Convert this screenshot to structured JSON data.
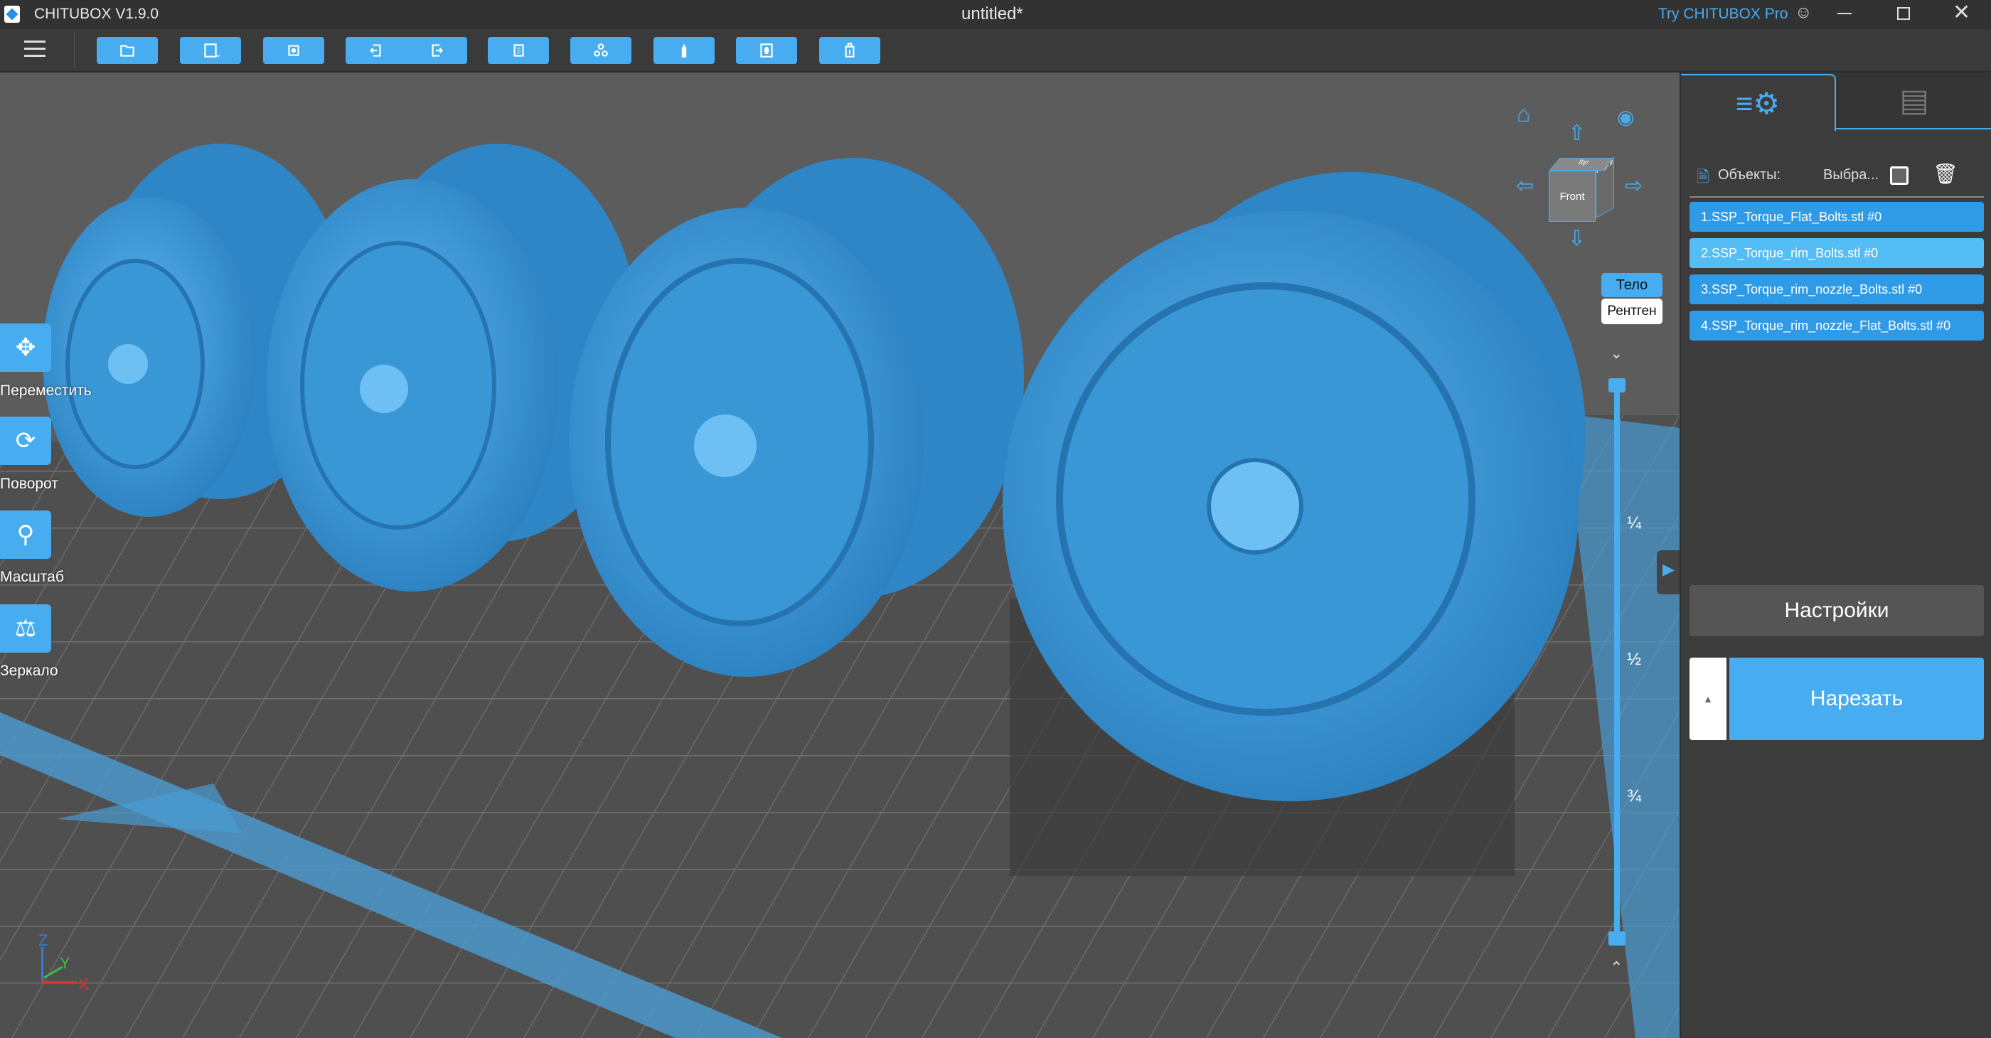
{
  "app": {
    "title": "CHITUBOX V1.9.0",
    "document": "untitled*",
    "pro_link": "Try CHITUBOX Pro"
  },
  "toolbar": {
    "buttons": [
      "open-file",
      "save",
      "auto-layout",
      "undo",
      "redo",
      "copy",
      "arrange",
      "support",
      "hollow",
      "dig-hole"
    ]
  },
  "left_tools": [
    {
      "label": "Переместить",
      "icon": "move-icon"
    },
    {
      "label": "Поворот",
      "icon": "rotate-icon"
    },
    {
      "label": "Масштаб",
      "icon": "scale-icon"
    },
    {
      "label": "Зеркало",
      "icon": "mirror-icon"
    }
  ],
  "view": {
    "cube_front": "Front",
    "cube_right": "Right",
    "cube_top": "Top",
    "modes": [
      "Тело",
      "Рентген"
    ],
    "active_mode": "Тело"
  },
  "slider": {
    "fractions": [
      "¼",
      "½",
      "¾"
    ],
    "top_value": 1,
    "bottom_value": 0
  },
  "axes": {
    "z": "Z",
    "y": "Y",
    "x": "X"
  },
  "panel": {
    "objects_label": "Объекты:",
    "select_label": "Выбра...",
    "objects": [
      "1.SSP_Torque_Flat_Bolts.stl #0",
      "2.SSP_Torque_rim_Bolts.stl #0",
      "3.SSP_Torque_rim_nozzle_Bolts.stl #0",
      "4.SSP_Torque_rim_nozzle_Flat_Bolts.stl #0"
    ],
    "selected_index": 1,
    "settings_label": "Настройки",
    "slice_label": "Нарезать"
  },
  "colors": {
    "accent": "#47adf0",
    "model": "#3a98d8",
    "panel": "#3c3c3c"
  }
}
